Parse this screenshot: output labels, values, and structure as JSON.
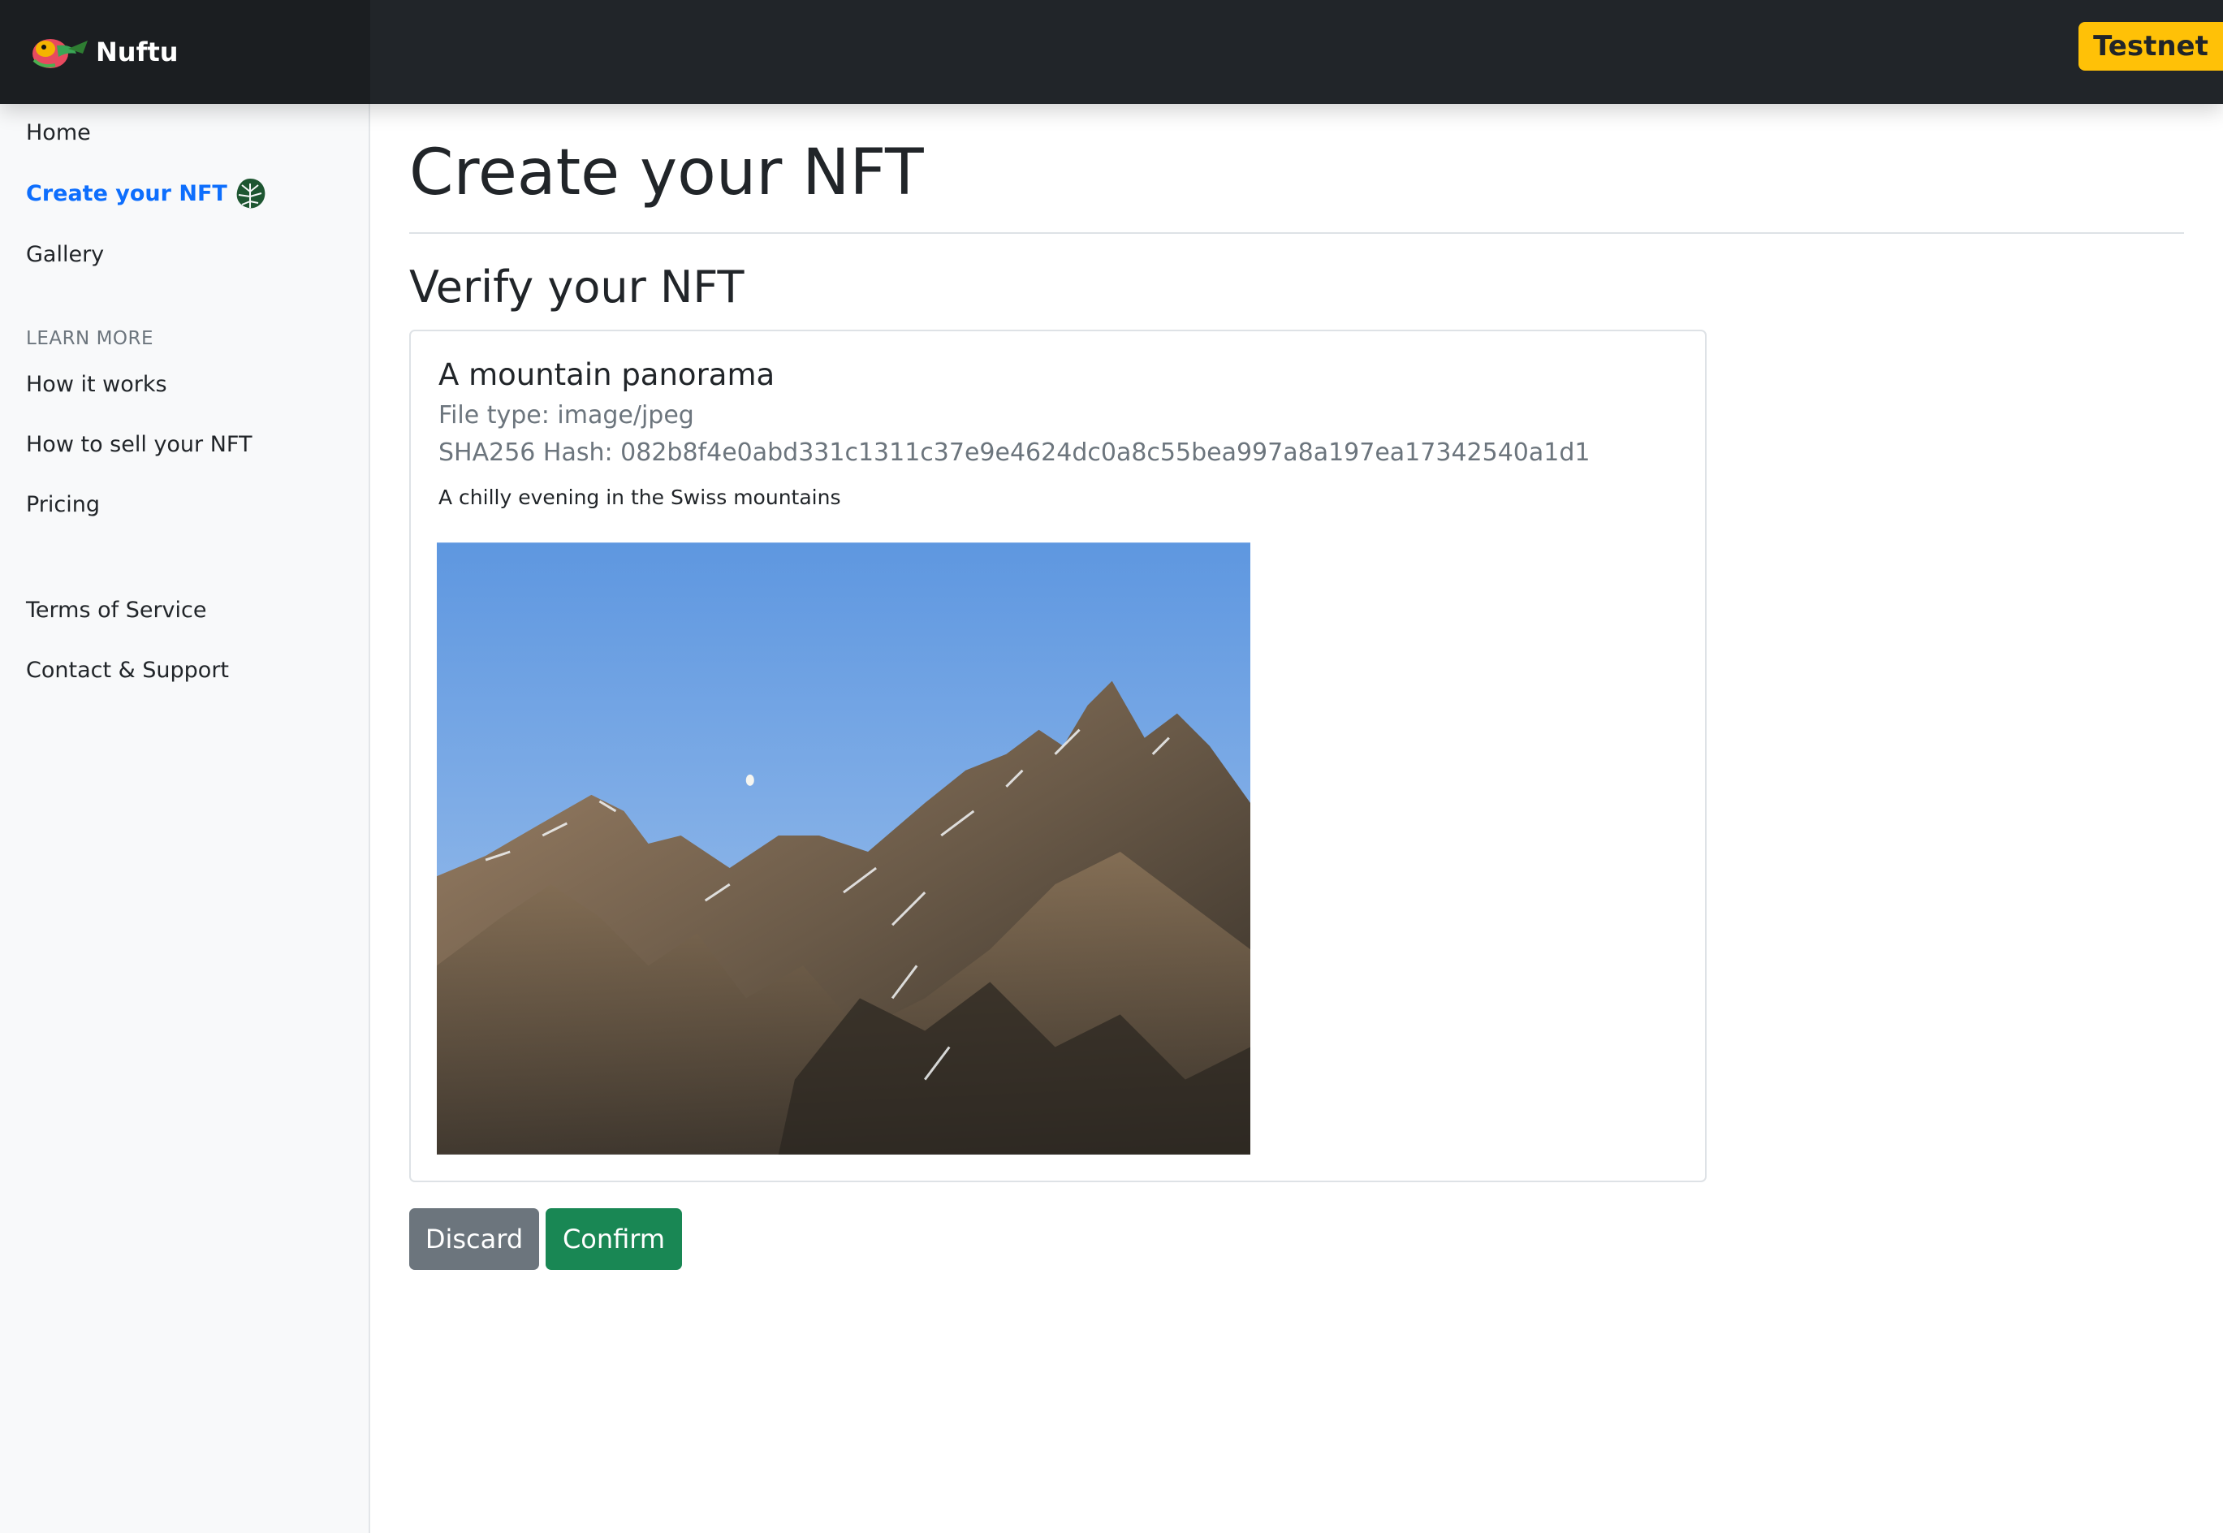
{
  "header": {
    "brand_name": "Nuftu",
    "network_badge": "Testnet"
  },
  "sidebar": {
    "items": [
      {
        "label": "Home"
      },
      {
        "label": "Create your NFT",
        "active": true
      },
      {
        "label": "Gallery"
      }
    ],
    "learn_more_heading": "Learn more",
    "learn_items": [
      {
        "label": "How it works"
      },
      {
        "label": "How to sell your NFT"
      },
      {
        "label": "Pricing"
      }
    ],
    "footer_items": [
      {
        "label": "Terms of Service"
      },
      {
        "label": "Contact & Support"
      }
    ]
  },
  "main": {
    "page_title": "Create your NFT",
    "section_title": "Verify your NFT",
    "card": {
      "title": "A mountain panorama",
      "file_type": "File type: image/jpeg",
      "hash": "SHA256 Hash: 082b8f4e0abd331c1311c37e9e4624dc0a8c55bea997a8a197ea17342540a1d1",
      "description": "A chilly evening in the Swiss mountains"
    },
    "buttons": {
      "discard": "Discard",
      "confirm": "Confirm"
    }
  },
  "colors": {
    "navbar": "#212529",
    "accent": "#0d6efd",
    "badge": "#ffc107",
    "confirm": "#198754",
    "discard": "#6c757d"
  }
}
